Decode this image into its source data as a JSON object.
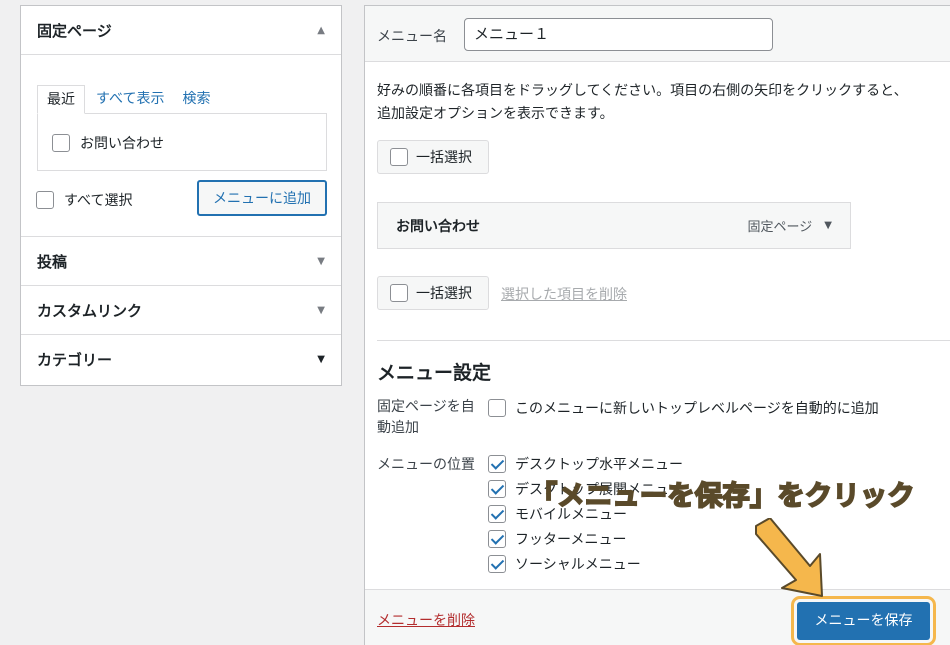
{
  "left": {
    "fixed_pages": {
      "title": "固定ページ",
      "tabs": [
        "最近",
        "すべて表示",
        "検索"
      ],
      "items": [
        "お問い合わせ"
      ],
      "select_all": "すべて選択",
      "add_button": "メニューに追加"
    },
    "sections": [
      "投稿",
      "カスタムリンク",
      "カテゴリー"
    ]
  },
  "right": {
    "menu_name_label": "メニュー名",
    "menu_name_value": "メニュー１",
    "instructions": "好みの順番に各項目をドラッグしてください。項目の右側の矢印をクリックすると、追加設定オプションを表示できます。",
    "bulk_select": "一括選択",
    "menu_item": {
      "title": "お問い合わせ",
      "type": "固定ページ"
    },
    "delete_selected": "選択した項目を削除",
    "settings_title": "メニュー設定",
    "auto_add_label": "固定ページを自動追加",
    "auto_add_option": "このメニューに新しいトップレベルページを自動的に追加",
    "location_label": "メニューの位置",
    "locations": [
      "デスクトップ水平メニュー",
      "デスクトップ展開メニュー",
      "モバイルメニュー",
      "フッターメニュー",
      "ソーシャルメニュー"
    ],
    "delete_menu": "メニューを削除",
    "save_menu": "メニューを保存"
  },
  "annotation": "「メニューを保存」をクリック",
  "colors": {
    "accent": "#2271b1",
    "annotation": "#f5b74c",
    "danger": "#b32d2e"
  }
}
